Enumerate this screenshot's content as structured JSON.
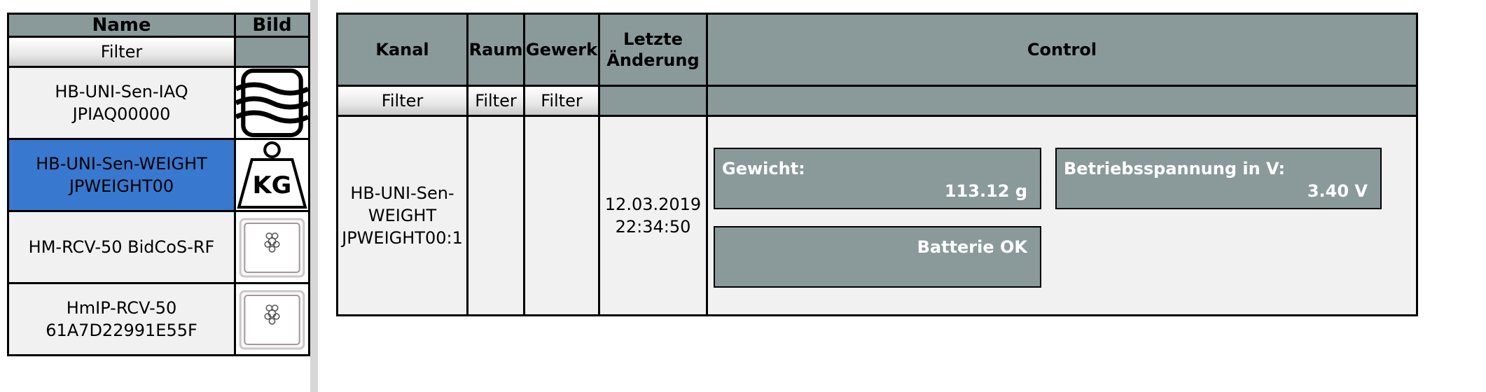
{
  "device_list": {
    "headers": {
      "name": "Name",
      "image": "Bild"
    },
    "filter_label": "Filter",
    "devices": [
      {
        "name": "HB-UNI-Sen-IAQ",
        "serial": "JPIAQ00000",
        "icon": "air-quality-icon",
        "selected": false
      },
      {
        "name": "HB-UNI-Sen-WEIGHT",
        "serial": "JPWEIGHT00",
        "icon": "weight-kg-icon",
        "selected": true
      },
      {
        "name": "HM-RCV-50 BidCoS-RF",
        "serial": "",
        "icon": "raspberry-pi-board-icon",
        "selected": false
      },
      {
        "name": "HmIP-RCV-50",
        "serial": "61A7D22991E55F",
        "icon": "raspberry-pi-board-icon",
        "selected": false
      }
    ]
  },
  "channel_table": {
    "headers": {
      "kanal": "Kanal",
      "raum": "Raum",
      "gewerk": "Gewerk",
      "letzte_line1": "Letzte",
      "letzte_line2": "Änderung",
      "control": "Control"
    },
    "filter_label": "Filter",
    "row": {
      "kanal_line1": "HB-UNI-Sen-",
      "kanal_line2": "WEIGHT",
      "kanal_line3": "JPWEIGHT00:1",
      "raum": "",
      "gewerk": "",
      "date": "12.03.2019",
      "time": "22:34:50",
      "controls": {
        "gewicht_label": "Gewicht:",
        "gewicht_value": "113.12 g",
        "spannung_label": "Betriebsspannung in V:",
        "spannung_value": "3.40 V",
        "batterie": "Batterie OK"
      }
    }
  },
  "colors": {
    "header_gray": "#8a9a9b",
    "selected_blue": "#3978cf",
    "row_bg": "#f1f1f1"
  }
}
